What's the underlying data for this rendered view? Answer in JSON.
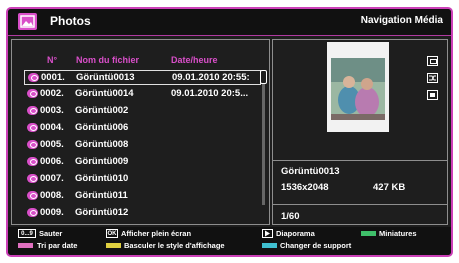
{
  "header": {
    "title": "Photos",
    "navigation": "Navigation Média"
  },
  "columns": {
    "num": "N°",
    "name": "Nom du fichier",
    "date": "Date/heure"
  },
  "files": [
    {
      "num": "0001.",
      "name": "Görüntü0013",
      "date": "09.01.2010 20:55:",
      "selected": true
    },
    {
      "num": "0002.",
      "name": "Görüntü0014",
      "date": "09.01.2010 20:5..."
    },
    {
      "num": "0003.",
      "name": "Görüntü002",
      "date": ""
    },
    {
      "num": "0004.",
      "name": "Görüntü006",
      "date": ""
    },
    {
      "num": "0005.",
      "name": "Görüntü008",
      "date": ""
    },
    {
      "num": "0006.",
      "name": "Görüntü009",
      "date": ""
    },
    {
      "num": "0007.",
      "name": "Görüntü010",
      "date": ""
    },
    {
      "num": "0008.",
      "name": "Görüntü011",
      "date": ""
    },
    {
      "num": "0009.",
      "name": "Görüntü012",
      "date": ""
    }
  ],
  "info": {
    "filename": "Görüntü0013",
    "resolution": "1536x2048",
    "size": "427 KB",
    "position": "1/60"
  },
  "footer": {
    "jump_key": "0...9",
    "jump": "Sauter",
    "ok_key": "OK",
    "fullscreen": "Afficher plein écran",
    "slideshow": "Diaporama",
    "thumbnails": "Miniatures",
    "sort_date": "Tri par date",
    "toggle_view": "Basculer le style d'affichage",
    "change_source": "Changer de support"
  },
  "colors": {
    "accent": "#d94fc9",
    "green": "#3fbf6a",
    "yellow": "#e0d040",
    "cyan": "#3fbfd0",
    "pink": "#e070c0"
  }
}
